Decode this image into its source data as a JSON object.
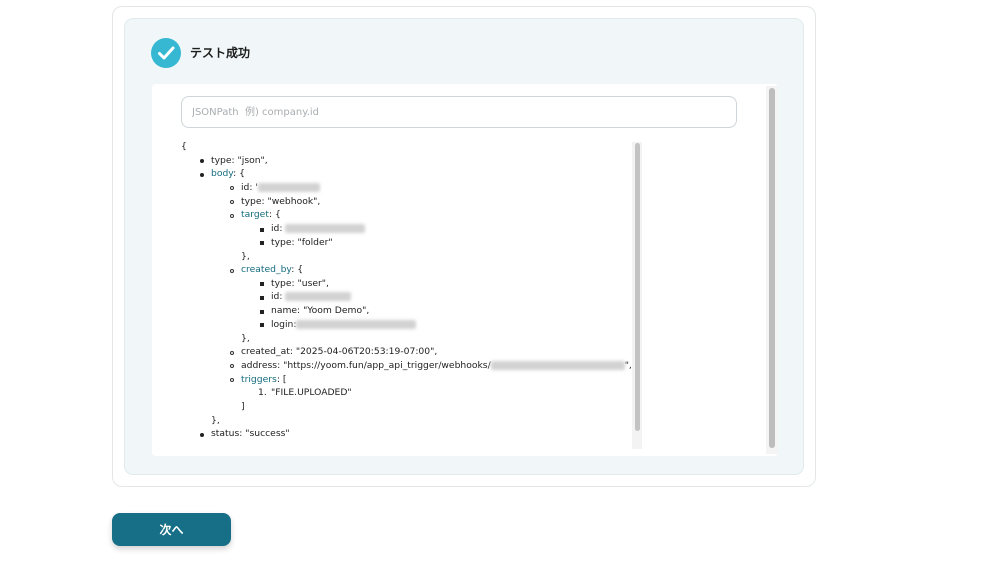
{
  "result": {
    "title": "テスト成功",
    "search_placeholder": "JSONPath  例) company.id"
  },
  "json": {
    "open_brace": "{",
    "type": "type: \"json\",",
    "body_key": "body",
    "body_open": ": {",
    "id_label": "id: '",
    "body_type": "type: \"webhook\",",
    "target_key": "target",
    "target_open": ": {",
    "target_id_label": "id:",
    "target_type": "type: \"folder\"",
    "target_close": "},",
    "created_by_key": "created_by",
    "created_by_open": ": {",
    "cb_type": "type: \"user\",",
    "cb_id_label": "id:",
    "cb_name": "name: \"Yoom Demo\",",
    "cb_login_label": "login:",
    "created_by_close": "},",
    "created_at": "created_at: \"2025-04-06T20:53:19-07:00\",",
    "address_prefix": "address: \"https://yoom.fun/app_api_trigger/webhooks/",
    "address_suffix": "\",",
    "triggers_key": "triggers",
    "triggers_open": ": [",
    "trigger_item_num": "1.",
    "trigger_item": "\"FILE.UPLOADED\"",
    "triggers_close": "]",
    "body_close": "},",
    "status": "status: \"success\""
  },
  "footer": {
    "next_label": "次へ"
  },
  "colors": {
    "accent": "#36b8d3",
    "button": "#166f87",
    "key_link": "#146b7e",
    "panel_bg": "#f1f7f8"
  },
  "icons": {
    "success": "check-circle-icon"
  }
}
